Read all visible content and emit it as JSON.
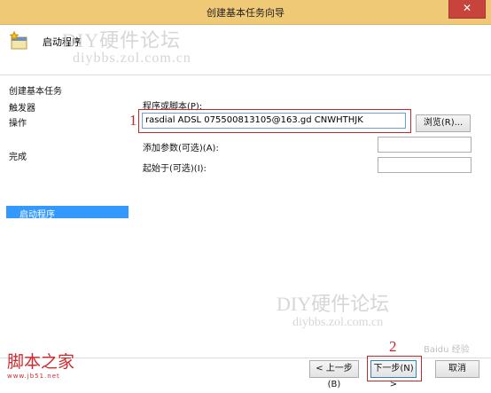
{
  "window": {
    "title": "创建基本任务向导",
    "close_glyph": "✕"
  },
  "header": {
    "title": "启动程序"
  },
  "watermarks": {
    "line1": "DIY硬件论坛",
    "line2": "diybbs.zol.com.cn",
    "line3": "DIY硬件论坛",
    "line4": "diybbs.zol.com.cn",
    "corner": "Baidu 经验"
  },
  "sidebar": {
    "items": [
      "创建基本任务",
      "触发器",
      "操作",
      "启动程序",
      "完成"
    ]
  },
  "form": {
    "program_label": "程序或脚本(P):",
    "program_value": "rasdial ADSL 075500813105@163.gd CNWHTHJK",
    "browse_label": "浏览(R)...",
    "args_label": "添加参数(可选)(A):",
    "args_value": "",
    "start_label": "起始于(可选)(I):",
    "start_value": ""
  },
  "markers": {
    "one": "1",
    "two": "2"
  },
  "buttons": {
    "back": "< 上一步(B)",
    "next": "下一步(N) >",
    "cancel": "取消"
  },
  "logo": {
    "text": "脚本之家",
    "url": "www.jb51.net"
  }
}
